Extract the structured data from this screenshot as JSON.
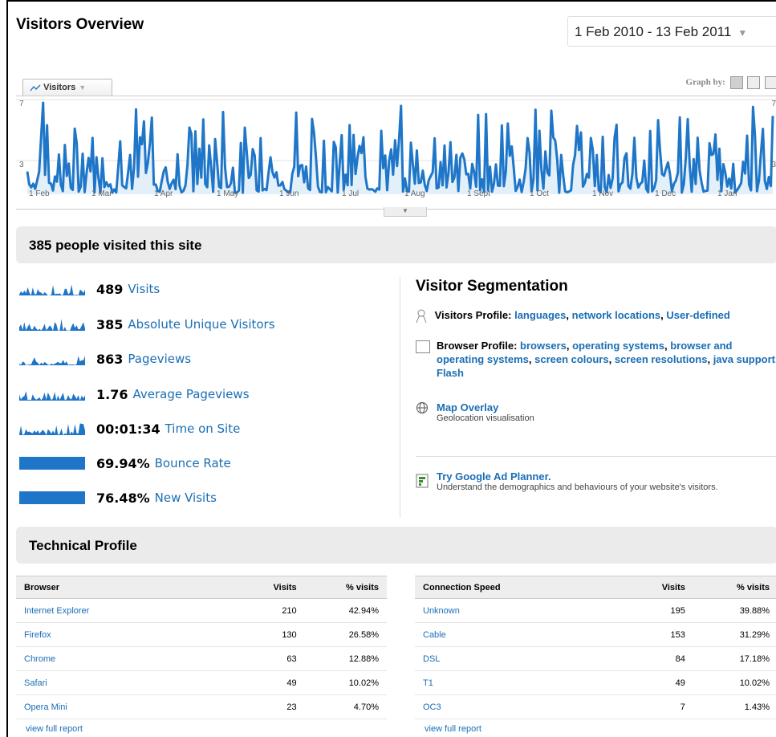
{
  "header": {
    "title": "Visitors Overview",
    "date_range": "1 Feb 2010 - 13 Feb 2011"
  },
  "graph": {
    "metric_tab": "Visitors",
    "graph_by_label": "Graph by:",
    "y_max_label": "7",
    "y_mid_label": "3",
    "x_labels": [
      "1 Feb",
      "1 Mar",
      "1 Apr",
      "1 May",
      "1 Jun",
      "1 Jul",
      "1 Aug",
      "1 Sept",
      "1 Oct",
      "1 Nov",
      "1 Dec",
      "1 Jan"
    ]
  },
  "summary": {
    "headline": "385 people visited this site"
  },
  "metrics": [
    {
      "value": "489",
      "label": "Visits"
    },
    {
      "value": "385",
      "label": "Absolute Unique Visitors"
    },
    {
      "value": "863",
      "label": "Pageviews"
    },
    {
      "value": "1.76",
      "label": "Average Pageviews"
    },
    {
      "value": "00:01:34",
      "label": "Time on Site"
    },
    {
      "value": "69.94%",
      "label": "Bounce Rate"
    },
    {
      "value": "76.48%",
      "label": "New Visits"
    }
  ],
  "segmentation": {
    "title": "Visitor Segmentation",
    "visitors_profile_label": "Visitors Profile:",
    "visitors_profile_links": [
      "languages",
      "network locations",
      "User-defined"
    ],
    "browser_profile_label": "Browser Profile:",
    "browser_profile_links": [
      "browsers",
      "operating systems",
      "browser and operating systems",
      "screen colours",
      "screen resolutions",
      "java support",
      "Flash"
    ],
    "map_overlay": "Map Overlay",
    "map_overlay_desc": "Geolocation visualisation",
    "ad_planner": "Try Google Ad Planner.",
    "ad_planner_desc": "Understand the demographics and behaviours of your website's visitors."
  },
  "technical": {
    "title": "Technical Profile",
    "browser_table": {
      "headers": [
        "Browser",
        "Visits",
        "% visits"
      ],
      "rows": [
        [
          "Internet Explorer",
          "210",
          "42.94%"
        ],
        [
          "Firefox",
          "130",
          "26.58%"
        ],
        [
          "Chrome",
          "63",
          "12.88%"
        ],
        [
          "Safari",
          "49",
          "10.02%"
        ],
        [
          "Opera Mini",
          "23",
          "4.70%"
        ]
      ]
    },
    "connection_table": {
      "headers": [
        "Connection Speed",
        "Visits",
        "% visits"
      ],
      "rows": [
        [
          "Unknown",
          "195",
          "39.88%"
        ],
        [
          "Cable",
          "153",
          "31.29%"
        ],
        [
          "DSL",
          "84",
          "17.18%"
        ],
        [
          "T1",
          "49",
          "10.02%"
        ],
        [
          "OC3",
          "7",
          "1.43%"
        ]
      ]
    },
    "view_full_report": "view full report"
  },
  "colors": {
    "accent": "#1a6eb5",
    "line": "#1f76c8",
    "fill": "#e3f0fa"
  }
}
